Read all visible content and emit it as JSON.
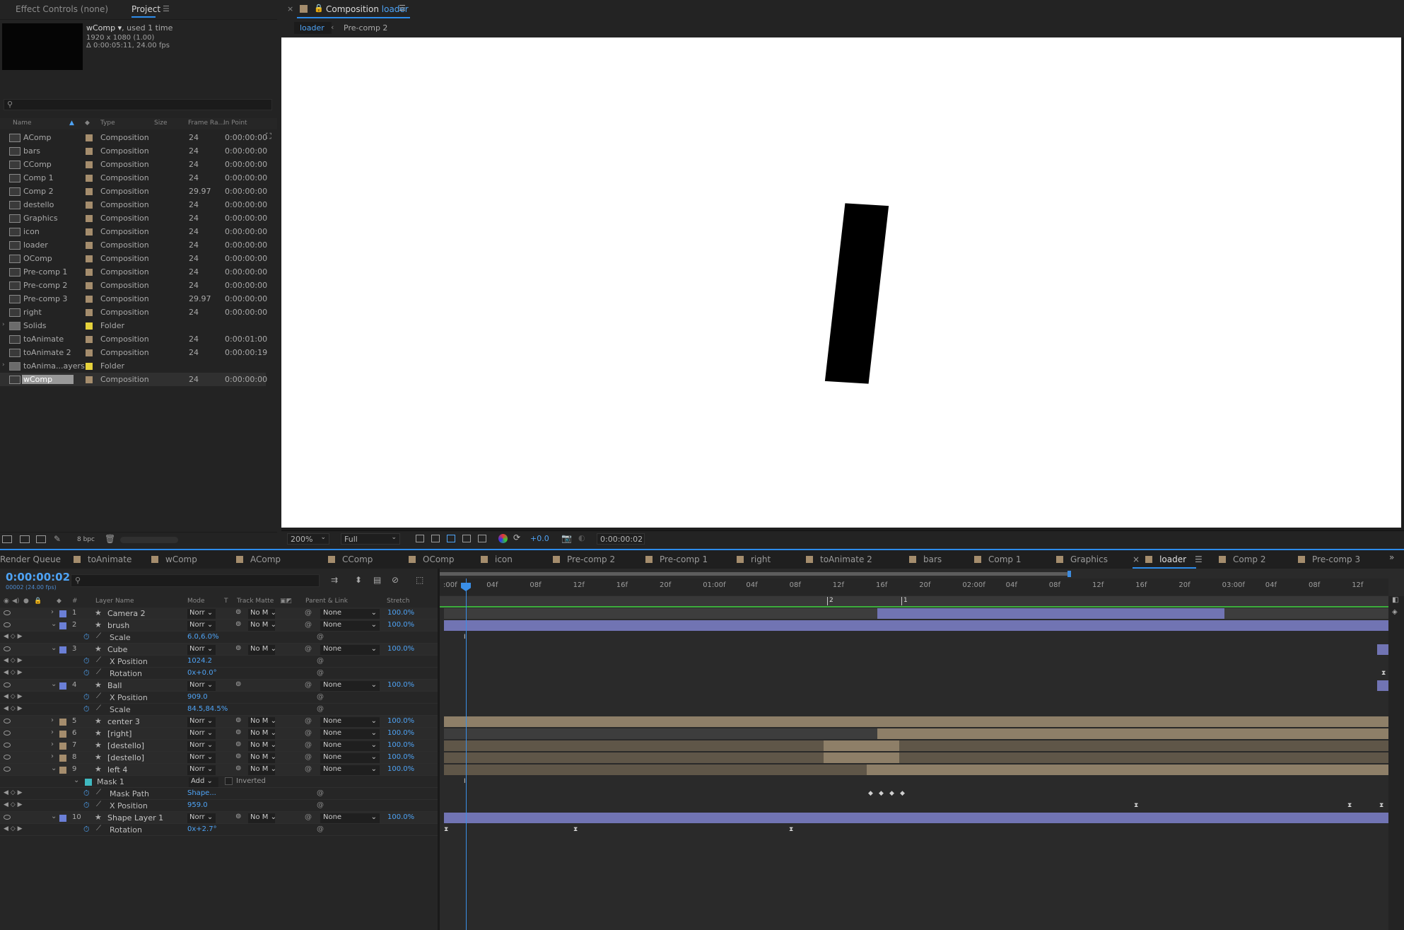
{
  "left_panel": {
    "tabs": [
      "Effect Controls (none)",
      "Project"
    ],
    "selected_item": {
      "name": "wComp ▾",
      "used": ", used 1 time",
      "size": "1920 x 1080 (1.00)",
      "duration": "Δ 0:00:05:11, 24.00 fps"
    },
    "columns": [
      "Name",
      "Type",
      "Size",
      "Frame Ra...",
      "In Point"
    ],
    "items": [
      {
        "name": "AComp",
        "type": "Composition",
        "fr": "24",
        "in": "0:00:00:00",
        "color": "#a58d6d",
        "kind": "comp"
      },
      {
        "name": "bars",
        "type": "Composition",
        "fr": "24",
        "in": "0:00:00:00",
        "color": "#a58d6d",
        "kind": "comp"
      },
      {
        "name": "CComp",
        "type": "Composition",
        "fr": "24",
        "in": "0:00:00:00",
        "color": "#a58d6d",
        "kind": "comp"
      },
      {
        "name": "Comp 1",
        "type": "Composition",
        "fr": "24",
        "in": "0:00:00:00",
        "color": "#a58d6d",
        "kind": "comp"
      },
      {
        "name": "Comp 2",
        "type": "Composition",
        "fr": "29.97",
        "in": "0:00:00:00",
        "color": "#a58d6d",
        "kind": "comp"
      },
      {
        "name": "destello",
        "type": "Composition",
        "fr": "24",
        "in": "0:00:00:00",
        "color": "#a58d6d",
        "kind": "comp"
      },
      {
        "name": "Graphics",
        "type": "Composition",
        "fr": "24",
        "in": "0:00:00:00",
        "color": "#a58d6d",
        "kind": "comp"
      },
      {
        "name": "icon",
        "type": "Composition",
        "fr": "24",
        "in": "0:00:00:00",
        "color": "#a58d6d",
        "kind": "comp"
      },
      {
        "name": "loader",
        "type": "Composition",
        "fr": "24",
        "in": "0:00:00:00",
        "color": "#a58d6d",
        "kind": "comp"
      },
      {
        "name": "OComp",
        "type": "Composition",
        "fr": "24",
        "in": "0:00:00:00",
        "color": "#a58d6d",
        "kind": "comp"
      },
      {
        "name": "Pre-comp 1",
        "type": "Composition",
        "fr": "24",
        "in": "0:00:00:00",
        "color": "#a58d6d",
        "kind": "comp"
      },
      {
        "name": "Pre-comp 2",
        "type": "Composition",
        "fr": "24",
        "in": "0:00:00:00",
        "color": "#a58d6d",
        "kind": "comp"
      },
      {
        "name": "Pre-comp 3",
        "type": "Composition",
        "fr": "29.97",
        "in": "0:00:00:00",
        "color": "#a58d6d",
        "kind": "comp"
      },
      {
        "name": "right",
        "type": "Composition",
        "fr": "24",
        "in": "0:00:00:00",
        "color": "#a58d6d",
        "kind": "comp"
      },
      {
        "name": "Solids",
        "type": "Folder",
        "fr": "",
        "in": "",
        "color": "#e6d23c",
        "kind": "folder"
      },
      {
        "name": "toAnimate",
        "type": "Composition",
        "fr": "24",
        "in": "0:00:01:00",
        "color": "#a58d6d",
        "kind": "comp"
      },
      {
        "name": "toAnimate 2",
        "type": "Composition",
        "fr": "24",
        "in": "0:00:00:19",
        "color": "#a58d6d",
        "kind": "comp"
      },
      {
        "name": "toAnima...ayers",
        "type": "Folder",
        "fr": "",
        "in": "",
        "color": "#e6d23c",
        "kind": "folder"
      },
      {
        "name": "wComp",
        "type": "Composition",
        "fr": "24",
        "in": "0:00:00:00",
        "color": "#a58d6d",
        "kind": "comp",
        "selected": true
      }
    ],
    "footer_bpc": "8 bpc"
  },
  "comp_panel": {
    "title_prefix": "Composition",
    "title_name": "loader",
    "breadcrumb": [
      "loader",
      "Pre-comp 2"
    ],
    "zoom": "200%",
    "resolution": "Full",
    "exposure": "+0.0",
    "timecode": "0:00:00:02"
  },
  "timeline": {
    "tabs": [
      "Render Queue",
      "toAnimate",
      "wComp",
      "AComp",
      "CComp",
      "OComp",
      "icon",
      "Pre-comp 2",
      "Pre-comp 1",
      "right",
      "toAnimate 2",
      "bars",
      "Comp 1",
      "Graphics",
      "loader",
      "Comp 2",
      "Pre-comp 3"
    ],
    "active_tab": "loader",
    "timecode": "0:00:00:02",
    "fps": "00002 (24.00 fps)",
    "columns": [
      "#",
      "Layer Name",
      "Mode",
      "T",
      "Track Matte",
      "Parent & Link",
      "Stretch"
    ],
    "ruler": [
      ":00f",
      "04f",
      "08f",
      "12f",
      "16f",
      "20f",
      "01:00f",
      "04f",
      "08f",
      "12f",
      "16f",
      "20f",
      "02:00f",
      "04f",
      "08f",
      "12f",
      "16f",
      "20f",
      "03:00f",
      "04f",
      "08f",
      "12f"
    ],
    "markers": [
      "2",
      "1"
    ],
    "mode_value": "Norr",
    "matte_value": "No M",
    "parent_value": "None",
    "stretch_value": "100.0%",
    "rows": [
      {
        "kind": "layer",
        "num": "1",
        "name": "Camera 2",
        "color": "#6b7fd6",
        "parent": true
      },
      {
        "kind": "layer",
        "num": "2",
        "name": "brush",
        "color": "#6b7fd6",
        "open": true
      },
      {
        "kind": "prop",
        "name": "Scale",
        "value": "6.0,6.0%"
      },
      {
        "kind": "layer",
        "num": "3",
        "name": "Cube",
        "color": "#6b7fd6",
        "open": true
      },
      {
        "kind": "prop",
        "name": "X Position",
        "value": "1024.2"
      },
      {
        "kind": "prop",
        "name": "Rotation",
        "value": "0x+0.0°"
      },
      {
        "kind": "layer",
        "num": "4",
        "name": "Ball",
        "color": "#6b7fd6",
        "open": true,
        "nomatte": true
      },
      {
        "kind": "prop",
        "name": "X Position",
        "value": "909.0"
      },
      {
        "kind": "prop",
        "name": "Scale",
        "value": "84.5,84.5%"
      },
      {
        "kind": "layer",
        "num": "5",
        "name": "center 3",
        "color": "#a58d6d"
      },
      {
        "kind": "layer",
        "num": "6",
        "name": "[right]",
        "color": "#a58d6d"
      },
      {
        "kind": "layer",
        "num": "7",
        "name": "[destello]",
        "color": "#a58d6d"
      },
      {
        "kind": "layer",
        "num": "8",
        "name": "[destello]",
        "color": "#a58d6d"
      },
      {
        "kind": "layer",
        "num": "9",
        "name": "left 4",
        "color": "#a58d6d",
        "open": true
      },
      {
        "kind": "mask",
        "name": "Mask 1",
        "value": "Add",
        "extra": "Inverted"
      },
      {
        "kind": "prop",
        "name": "Mask Path",
        "value": "Shape..."
      },
      {
        "kind": "prop",
        "name": "X Position",
        "value": "959.0"
      },
      {
        "kind": "layer",
        "num": "10",
        "name": "Shape Layer 1",
        "color": "#6b7fd6",
        "open": true
      },
      {
        "kind": "prop",
        "name": "Rotation",
        "value": "0x+2.7°"
      }
    ]
  }
}
